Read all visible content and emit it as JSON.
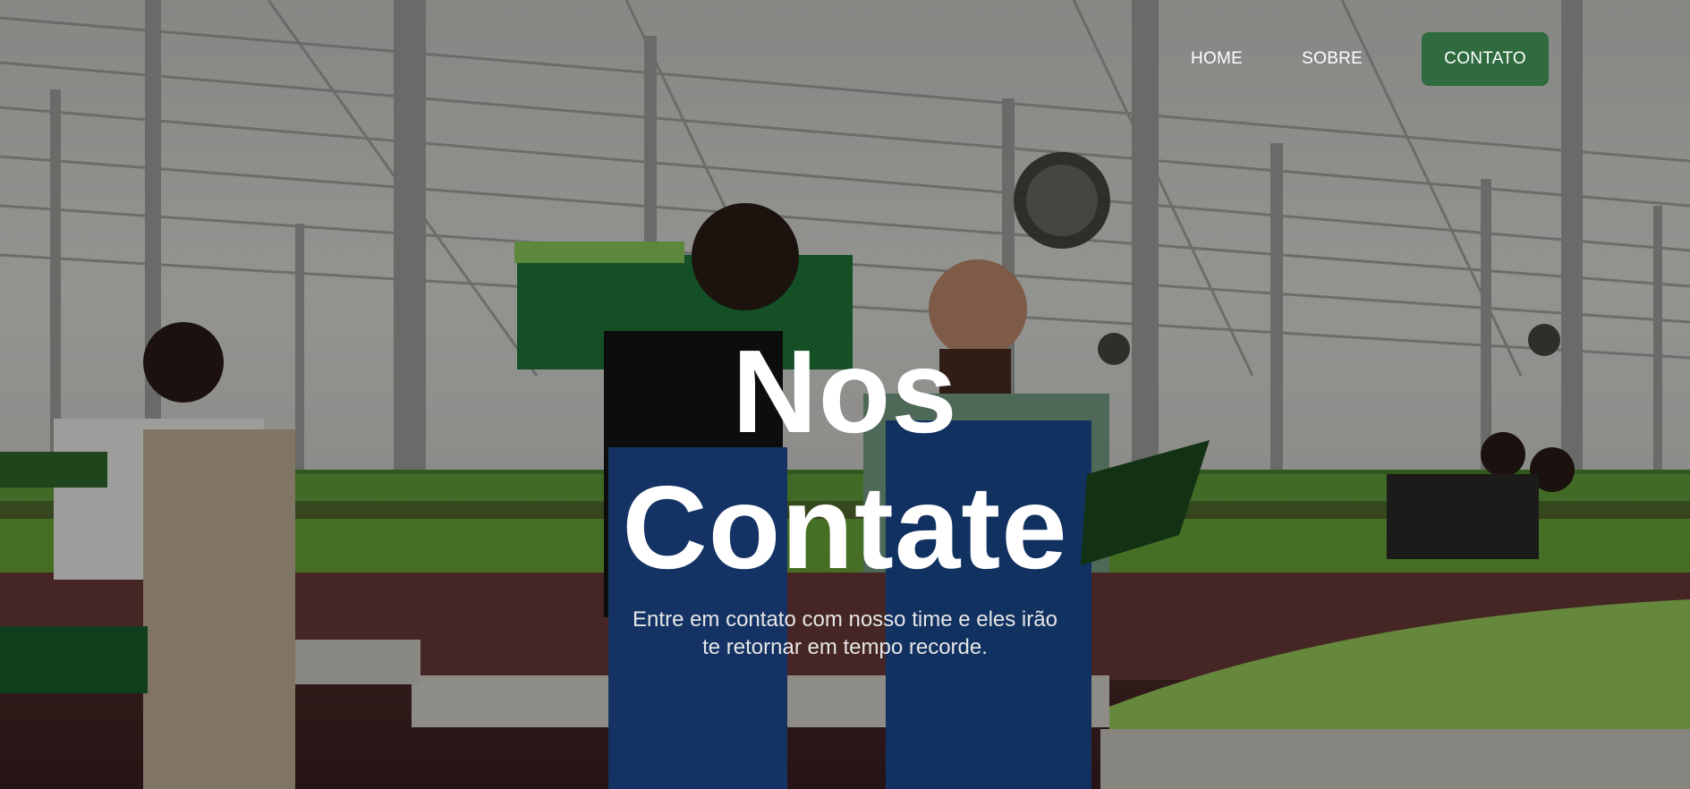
{
  "nav": {
    "home_label": "HOME",
    "sobre_label": "SOBRE",
    "contato_label": "CONTATO"
  },
  "hero": {
    "title_line1": "Nos",
    "title_line2": "Contate",
    "subtitle_line1": "Entre em contato com nosso time e eles irão",
    "subtitle_line2": "te retornar em tempo recorde."
  },
  "colors": {
    "cta_background": "#2f6b3f",
    "text": "#ffffff"
  }
}
